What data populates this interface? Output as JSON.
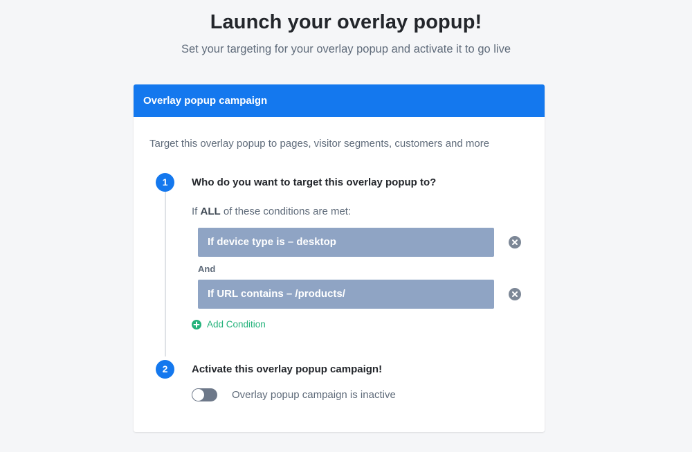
{
  "page": {
    "title": "Launch your overlay popup!",
    "subtitle": "Set your targeting for your overlay popup and activate it to go live"
  },
  "card": {
    "header": "Overlay popup campaign",
    "intro": "Target this overlay popup to pages, visitor segments, customers and more",
    "accent_color": "#1478ee"
  },
  "step1": {
    "number": "1",
    "title": "Who do you want to target this overlay popup to?",
    "conditions_intro_prefix": "If",
    "conditions_intro_emphasis": "ALL",
    "conditions_intro_suffix": "of these conditions are met:",
    "conditions": [
      {
        "label": "If device type is – desktop",
        "remove_icon": "close-circle-icon"
      },
      {
        "label": "If URL contains – /products/",
        "remove_icon": "close-circle-icon"
      }
    ],
    "joiner": "And",
    "add_condition_label": "Add Condition",
    "add_icon": "plus-circle-icon",
    "add_color": "#23b27a"
  },
  "step2": {
    "number": "2",
    "title": "Activate this overlay popup campaign!",
    "toggle_active": false,
    "toggle_label": "Overlay popup campaign is inactive"
  }
}
